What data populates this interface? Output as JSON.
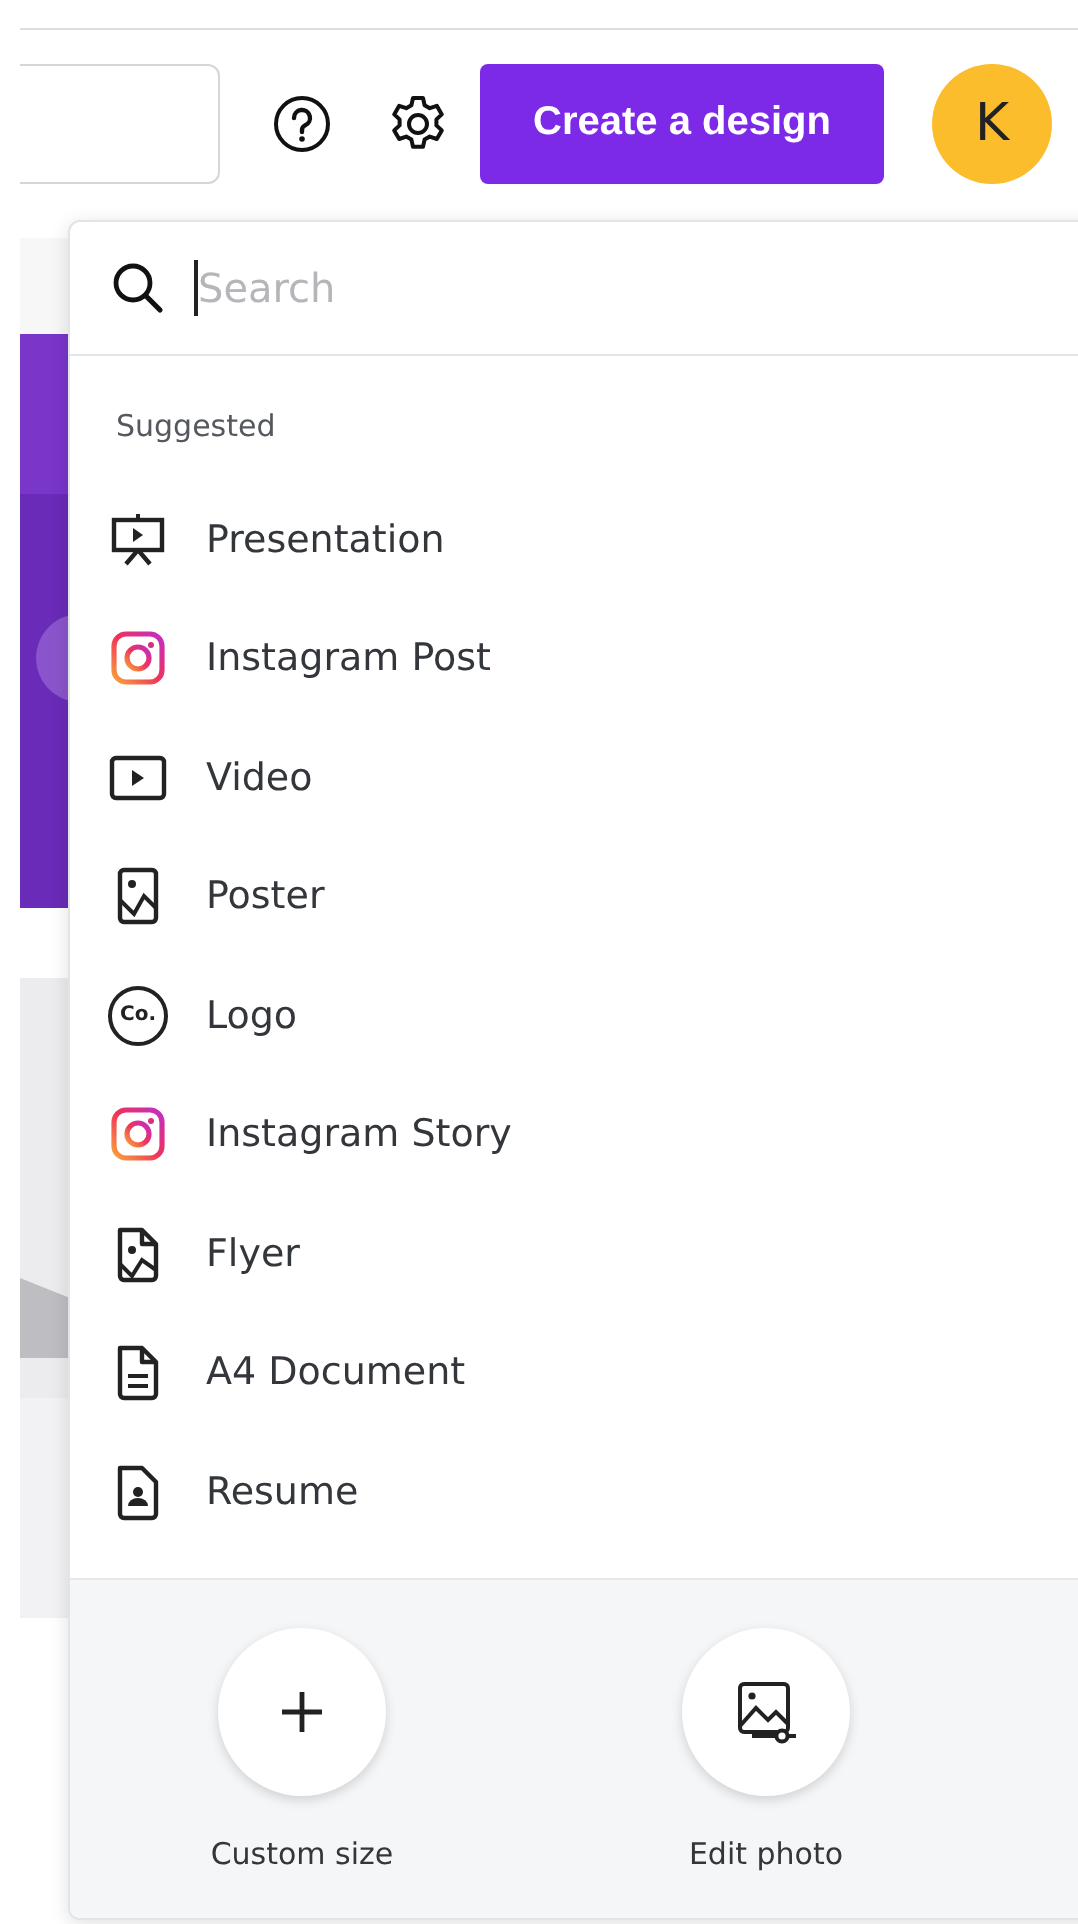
{
  "header": {
    "create_button": "Create a design",
    "avatar": "K"
  },
  "menu": {
    "search": {
      "placeholder": "Search"
    },
    "section_title": "Suggested",
    "items": [
      {
        "label": "Presentation",
        "kind": "presentation"
      },
      {
        "label": "Instagram Post",
        "kind": "instagram"
      },
      {
        "label": "Video",
        "kind": "video"
      },
      {
        "label": "Poster",
        "kind": "poster"
      },
      {
        "label": "Logo",
        "kind": "logo",
        "badge_text": "Co."
      },
      {
        "label": "Instagram Story",
        "kind": "instagram"
      },
      {
        "label": "Flyer",
        "kind": "flyer"
      },
      {
        "label": "A4 Document",
        "kind": "document"
      },
      {
        "label": "Resume",
        "kind": "resume"
      }
    ],
    "actions": [
      {
        "label": "Custom size",
        "kind": "plus"
      },
      {
        "label": "Edit photo"
      }
    ]
  }
}
